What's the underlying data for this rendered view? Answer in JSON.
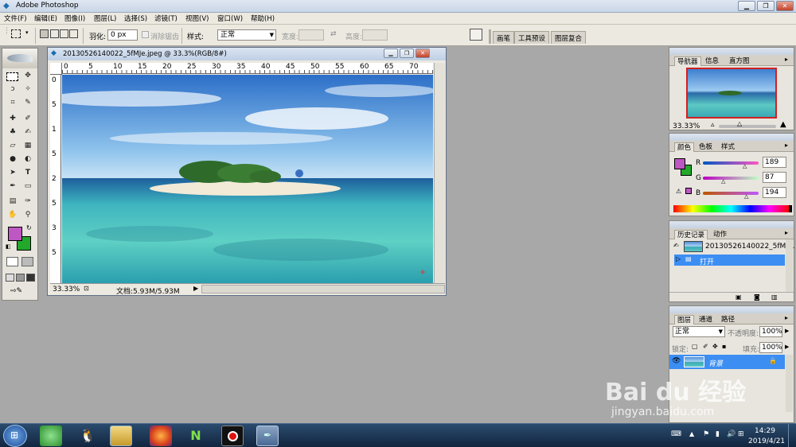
{
  "app_title": "Adobe Photoshop",
  "window_controls": {
    "minimize": "▁",
    "restore": "❐",
    "close": "✕"
  },
  "menu": [
    "文件(F)",
    "编辑(E)",
    "图像(I)",
    "图层(L)",
    "选择(S)",
    "滤镜(T)",
    "视图(V)",
    "窗口(W)",
    "帮助(H)"
  ],
  "options": {
    "feather_label": "羽化:",
    "feather_value": "0 px",
    "antialias_label": "消除锯齿",
    "style_label": "样式:",
    "style_value": "正常",
    "width_label": "宽度:",
    "height_label": "高度:",
    "swap_icon": "⇄"
  },
  "palette_tabs": [
    "画笔",
    "工具预设",
    "图层复合"
  ],
  "document": {
    "title": "20130526140022_5fMJe.jpeg @ 33.3%(RGB/8#)",
    "zoom": "33.33%",
    "doc_info": "文档:5.93M/5.93M",
    "ruler_h": [
      "0",
      "5",
      "10",
      "15",
      "20",
      "25",
      "30",
      "35",
      "40",
      "45",
      "50",
      "55",
      "60",
      "65",
      "70"
    ],
    "ruler_v": [
      "0",
      "5",
      "1",
      "5",
      "2",
      "5",
      "3",
      "5"
    ]
  },
  "colors": {
    "foreground": "#bd57c2",
    "background": "#22a82b"
  },
  "navigator": {
    "tabs": [
      "导航器",
      "信息",
      "直方图"
    ],
    "zoom": "33.33%"
  },
  "color_panel": {
    "tabs": [
      "颜色",
      "色板",
      "样式"
    ],
    "r_label": "R",
    "g_label": "G",
    "b_label": "B",
    "r": "189",
    "g": "87",
    "b": "194"
  },
  "history": {
    "tabs": [
      "历史记录",
      "动作"
    ],
    "snapshot": "20130526140022_5fMJ...",
    "step": "打开"
  },
  "layers": {
    "tabs": [
      "图层",
      "通道",
      "路径"
    ],
    "blend_mode": "正常",
    "opacity_label": "不透明度:",
    "opacity": "100%",
    "lock_label": "锁定:",
    "fill_label": "填充:",
    "fill": "100%",
    "layer_name": "背景"
  },
  "watermark": {
    "text": "Bai du 经验",
    "url": "jingyan.baidu.com"
  },
  "taskbar": {
    "time": "14:29",
    "date": "2019/4/21"
  }
}
